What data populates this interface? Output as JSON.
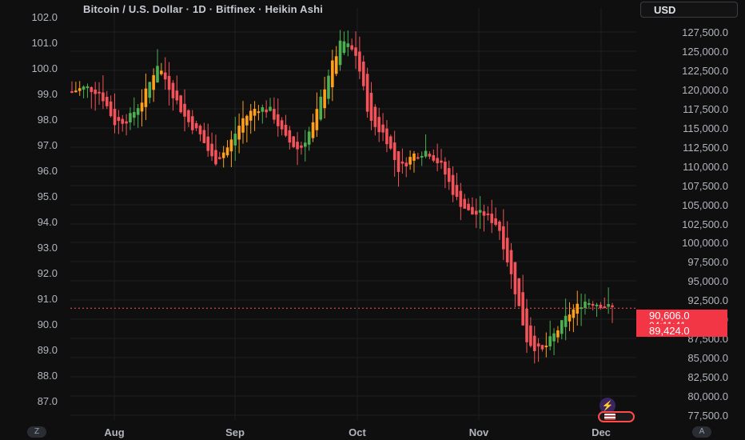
{
  "header": {
    "title": "Bitcoin / U.S. Dollar · 1D · Bitfinex · Heikin Ashi",
    "currency_button": "USD"
  },
  "left_axis": {
    "ticks": [
      "102.0",
      "101.0",
      "100.0",
      "99.0",
      "98.0",
      "97.0",
      "96.0",
      "95.0",
      "94.0",
      "93.0",
      "92.0",
      "91.0",
      "90.0",
      "89.0",
      "88.0",
      "87.0"
    ],
    "top_value": 102.0,
    "bottom_value": 87.0
  },
  "right_axis": {
    "ticks": [
      "127,500.0",
      "125,000.0",
      "122,500.0",
      "120,000.0",
      "117,500.0",
      "115,000.0",
      "112,500.0",
      "110,000.0",
      "107,500.0",
      "105,000.0",
      "102,500.0",
      "100,000.0",
      "97,500.0",
      "95,000.0",
      "92,500.0",
      "90,000.0",
      "87,500.0",
      "85,000.0",
      "82,500.0",
      "80,000.0",
      "77,500.0"
    ]
  },
  "x_axis": {
    "labels": [
      "Aug",
      "Sep",
      "Oct",
      "Nov",
      "Dec"
    ]
  },
  "price_labels": {
    "current_price": "90,606.0",
    "countdown": "04:11:41",
    "open_price": "89,424.0"
  },
  "bottom_controls": {
    "left_button": "Z",
    "right_button": "A"
  },
  "colors": {
    "background": "#0f0f0f",
    "bearish": "#f5525a",
    "bullish": "#4caf50",
    "neutral": "#ff9f1a",
    "grid": "#1e1f23",
    "axis_text": "#b2b5be",
    "price_label_bg": "#f23645"
  },
  "chart_data": {
    "type": "candlestick",
    "title": "Bitcoin / U.S. Dollar · 1D · Bitfinex · Heikin Ashi",
    "y_unit": "USD",
    "ylim": [
      76500,
      128500
    ],
    "x_range": [
      "2025-07-16",
      "2025-12-05"
    ],
    "dates": [
      "2025-07-16",
      "2025-07-21",
      "2025-07-26",
      "2025-07-31",
      "2025-08-05",
      "2025-08-10",
      "2025-08-14",
      "2025-08-18",
      "2025-08-22",
      "2025-08-26",
      "2025-08-31",
      "2025-09-05",
      "2025-09-10",
      "2025-09-15",
      "2025-09-20",
      "2025-09-25",
      "2025-09-29",
      "2025-10-01",
      "2025-10-04",
      "2025-10-06",
      "2025-10-08",
      "2025-10-10",
      "2025-10-14",
      "2025-10-18",
      "2025-10-22",
      "2025-10-26",
      "2025-10-29",
      "2025-11-01",
      "2025-11-04",
      "2025-11-08",
      "2025-11-12",
      "2025-11-16",
      "2025-11-20",
      "2025-11-22",
      "2025-11-25",
      "2025-11-28",
      "2025-12-01",
      "2025-12-03",
      "2025-12-05"
    ],
    "close": [
      118000,
      118500,
      117800,
      114000,
      114500,
      117000,
      121500,
      118000,
      114500,
      112500,
      109000,
      111000,
      114500,
      116000,
      115500,
      112000,
      110500,
      114000,
      120000,
      124500,
      122500,
      114000,
      112500,
      108000,
      110000,
      110500,
      108500,
      104500,
      102500,
      102500,
      101000,
      94000,
      86500,
      85000,
      87500,
      90000,
      91500,
      91200,
      90606
    ],
    "series_color_segments": [
      "bearish",
      "bullish",
      "neutral"
    ]
  }
}
